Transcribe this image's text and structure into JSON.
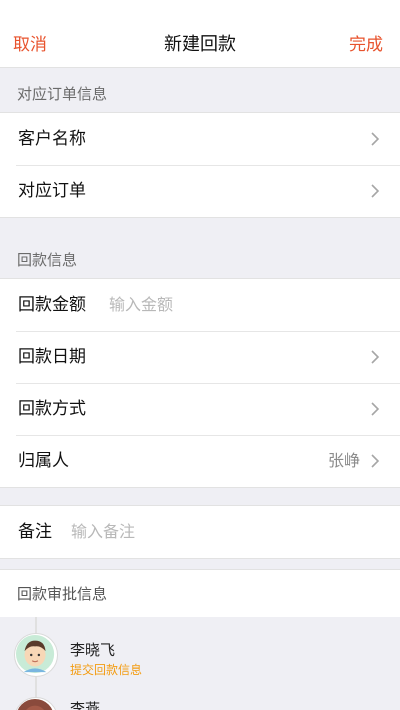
{
  "nav": {
    "cancel_label": "取消",
    "title": "新建回款",
    "done_label": "完成",
    "accent_color": "#e8532d"
  },
  "order_section": {
    "header": "对应订单信息",
    "rows": [
      {
        "label": "客户名称"
      },
      {
        "label": "对应订单"
      }
    ]
  },
  "payment_section": {
    "header": "回款信息",
    "amount_label": "回款金额",
    "amount_placeholder": "输入金额",
    "date_label": "回款日期",
    "method_label": "回款方式",
    "owner_label": "归属人",
    "owner_value": "张峥"
  },
  "remark": {
    "label": "备注",
    "placeholder": "输入备注"
  },
  "approval_section": {
    "header": "回款审批信息",
    "approvers": [
      {
        "name": "李晓飞",
        "status": "提交回款信息",
        "status_color": "#f39c12"
      },
      {
        "name": "李燕",
        "status": ""
      }
    ]
  }
}
